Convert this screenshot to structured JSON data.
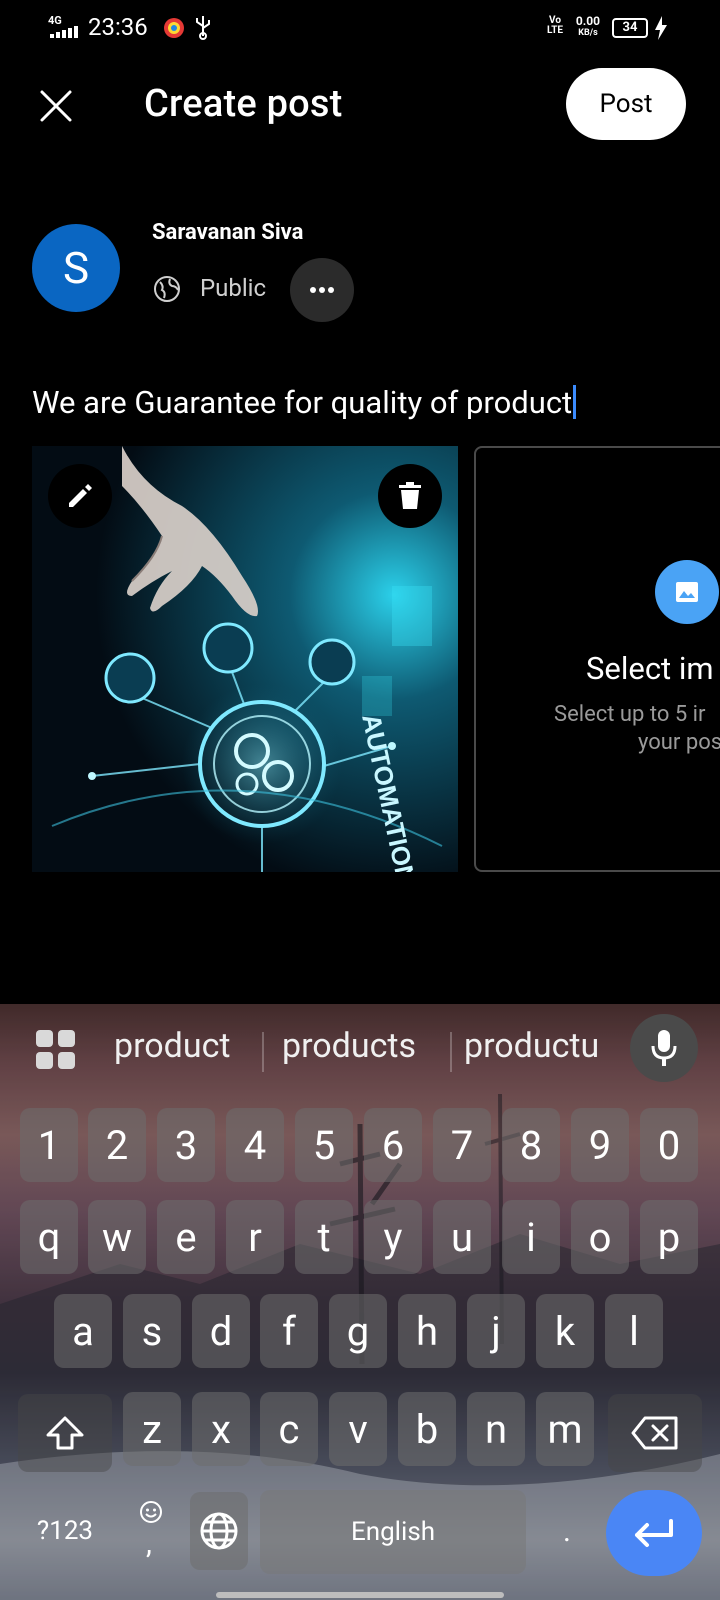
{
  "status_bar": {
    "network": "4G",
    "time": "23:36",
    "volte": "Vo LTE",
    "speed_value": "0.00",
    "speed_unit": "KB/s",
    "battery": "34"
  },
  "header": {
    "title": "Create post",
    "post_label": "Post",
    "close_icon": "close-icon"
  },
  "author": {
    "avatar_initial": "S",
    "name": "Saravanan Siva",
    "visibility": "Public",
    "avatar_color": "#0a66c2"
  },
  "post": {
    "text": "We are Guarantee for quality of product",
    "image_caption_art": "AUTOMATION"
  },
  "select_images": {
    "title": "Select im",
    "subtitle_line1": "Select up to 5 ir",
    "subtitle_line2": "your pos"
  },
  "keyboard": {
    "suggestions": [
      "product",
      "products",
      "productu"
    ],
    "row_numbers": [
      "1",
      "2",
      "3",
      "4",
      "5",
      "6",
      "7",
      "8",
      "9",
      "0"
    ],
    "row1": [
      "q",
      "w",
      "e",
      "r",
      "t",
      "y",
      "u",
      "i",
      "o",
      "p"
    ],
    "row2": [
      "a",
      "s",
      "d",
      "f",
      "g",
      "h",
      "j",
      "k",
      "l"
    ],
    "row3": [
      "z",
      "x",
      "c",
      "v",
      "b",
      "n",
      "m"
    ],
    "symbols_label": "?123",
    "comma": ",",
    "space_label": "English",
    "period": ".",
    "enter_color": "#4a86f5"
  }
}
